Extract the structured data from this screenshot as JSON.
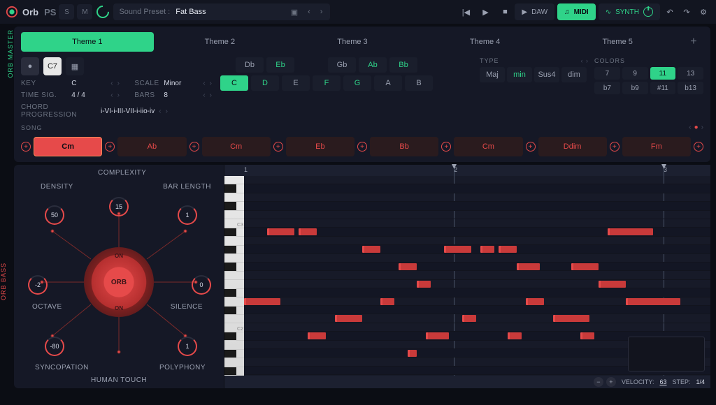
{
  "app": {
    "name": "Orb",
    "suffix": "PS"
  },
  "topbar": {
    "s": "S",
    "m": "M",
    "preset_label": "Sound Preset :",
    "preset_value": "Fat Bass",
    "daw": "DAW",
    "midi": "MIDI",
    "synth": "SYNTH"
  },
  "sidebar": {
    "master": "ORB MASTER",
    "bass": "ORB BASS"
  },
  "themes": [
    "Theme 1",
    "Theme 2",
    "Theme 3",
    "Theme 4",
    "Theme 5"
  ],
  "tools": {
    "chord_label": "C7"
  },
  "params": {
    "key_label": "KEY",
    "key": "C",
    "scale_label": "SCALE",
    "scale": "Minor",
    "timesig_label": "TIME SIG.",
    "timesig": "4 / 4",
    "bars_label": "BARS",
    "bars": "8",
    "prog_label": "CHORD PROGRESSION",
    "prog": "i-VI-i-III-VII-i-iio-iv"
  },
  "notes_flat": [
    "Db",
    "Eb",
    "",
    "Gb",
    "Ab",
    "Bb",
    ""
  ],
  "notes_nat": [
    "C",
    "D",
    "E",
    "F",
    "G",
    "A",
    "B"
  ],
  "notes_green_flat": [
    "Eb",
    "Ab",
    "Bb"
  ],
  "notes_nat_active": "C",
  "notes_nat_green": [
    "D",
    "F",
    "G"
  ],
  "type": {
    "label": "TYPE",
    "options": [
      "Maj",
      "min",
      "Sus4",
      "dim"
    ],
    "active": "min"
  },
  "colors": {
    "label": "COLORS",
    "row1": [
      "7",
      "9",
      "11",
      "13"
    ],
    "row2": [
      "b7",
      "b9",
      "#11",
      "b13"
    ],
    "active": "11"
  },
  "song": {
    "label": "SONG",
    "chords": [
      "Cm",
      "Ab",
      "Cm",
      "Eb",
      "Bb",
      "Cm",
      "Ddim",
      "Fm"
    ],
    "active_index": 0
  },
  "dial": {
    "labels": {
      "complexity": "COMPLEXITY",
      "density": "DENSITY",
      "barlength": "BAR LENGTH",
      "octave": "OCTAVE",
      "silence": "SILENCE",
      "syncopation": "SYNCOPATION",
      "polyphony": "POLYPHONY",
      "human": "HUMAN TOUCH"
    },
    "values": {
      "complexity": "15",
      "density": "50",
      "barlength": "1",
      "octave": "-2",
      "silence": "0",
      "syncopation": "-80",
      "polyphony": "1"
    },
    "orb": "ORB",
    "on": "ON"
  },
  "seq": {
    "bars": [
      "1",
      "2",
      "3"
    ],
    "octaves": [
      "C3",
      "C2"
    ],
    "footer": {
      "velocity_label": "VELOCITY:",
      "velocity": "63",
      "step_label": "STEP:",
      "step": "1/4"
    },
    "notes": [
      {
        "row": 6,
        "start": 5,
        "len": 6
      },
      {
        "row": 6,
        "start": 12,
        "len": 4
      },
      {
        "row": 6,
        "start": 80,
        "len": 10
      },
      {
        "row": 8,
        "start": 26,
        "len": 4
      },
      {
        "row": 8,
        "start": 44,
        "len": 6
      },
      {
        "row": 8,
        "start": 52,
        "len": 3
      },
      {
        "row": 8,
        "start": 56,
        "len": 4
      },
      {
        "row": 10,
        "start": 34,
        "len": 4
      },
      {
        "row": 10,
        "start": 60,
        "len": 5
      },
      {
        "row": 10,
        "start": 72,
        "len": 6
      },
      {
        "row": 12,
        "start": 38,
        "len": 3
      },
      {
        "row": 12,
        "start": 78,
        "len": 6
      },
      {
        "row": 14,
        "start": 0,
        "len": 8
      },
      {
        "row": 14,
        "start": 30,
        "len": 3
      },
      {
        "row": 14,
        "start": 62,
        "len": 4
      },
      {
        "row": 14,
        "start": 84,
        "len": 12
      },
      {
        "row": 16,
        "start": 20,
        "len": 6
      },
      {
        "row": 16,
        "start": 48,
        "len": 3
      },
      {
        "row": 16,
        "start": 68,
        "len": 8
      },
      {
        "row": 18,
        "start": 14,
        "len": 4
      },
      {
        "row": 18,
        "start": 40,
        "len": 5
      },
      {
        "row": 18,
        "start": 58,
        "len": 3
      },
      {
        "row": 18,
        "start": 74,
        "len": 3
      },
      {
        "row": 20,
        "start": 36,
        "len": 2
      }
    ]
  }
}
